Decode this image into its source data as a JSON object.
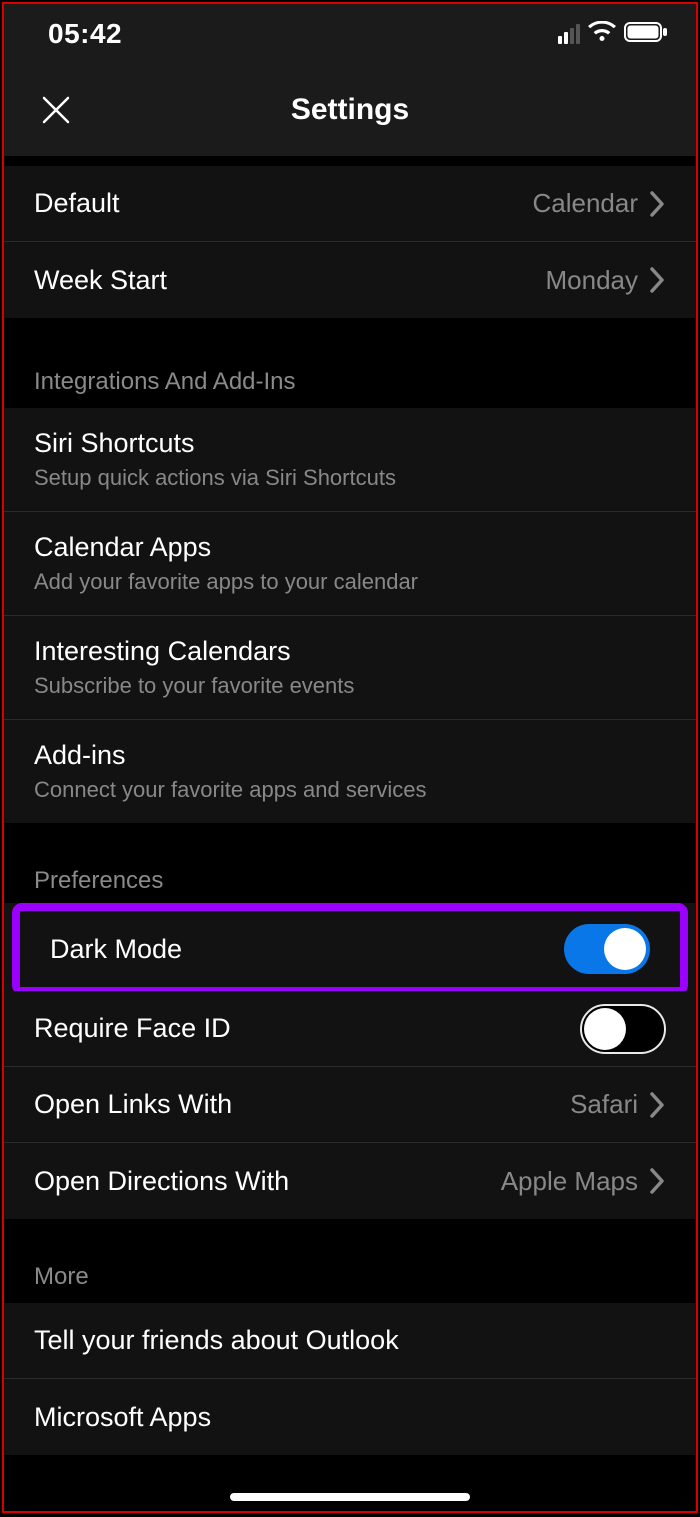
{
  "statusbar": {
    "time": "05:42"
  },
  "navbar": {
    "title": "Settings"
  },
  "top_rows": {
    "default": {
      "label": "Default",
      "value": "Calendar"
    },
    "week_start": {
      "label": "Week Start",
      "value": "Monday"
    }
  },
  "integrations": {
    "header": "Integrations And Add-Ins",
    "siri": {
      "label": "Siri Shortcuts",
      "sub": "Setup quick actions via Siri Shortcuts"
    },
    "calendar_apps": {
      "label": "Calendar Apps",
      "sub": "Add your favorite apps to your calendar"
    },
    "interesting": {
      "label": "Interesting Calendars",
      "sub": "Subscribe to your favorite events"
    },
    "addins": {
      "label": "Add-ins",
      "sub": "Connect your favorite apps and services"
    }
  },
  "preferences": {
    "header": "Preferences",
    "dark_mode": {
      "label": "Dark Mode",
      "on": true
    },
    "face_id": {
      "label": "Require Face ID",
      "on": false
    },
    "open_links": {
      "label": "Open Links With",
      "value": "Safari"
    },
    "open_dir": {
      "label": "Open Directions With",
      "value": "Apple Maps"
    }
  },
  "more": {
    "header": "More",
    "tell": {
      "label": "Tell your friends about Outlook"
    },
    "ms_apps": {
      "label": "Microsoft Apps"
    }
  }
}
